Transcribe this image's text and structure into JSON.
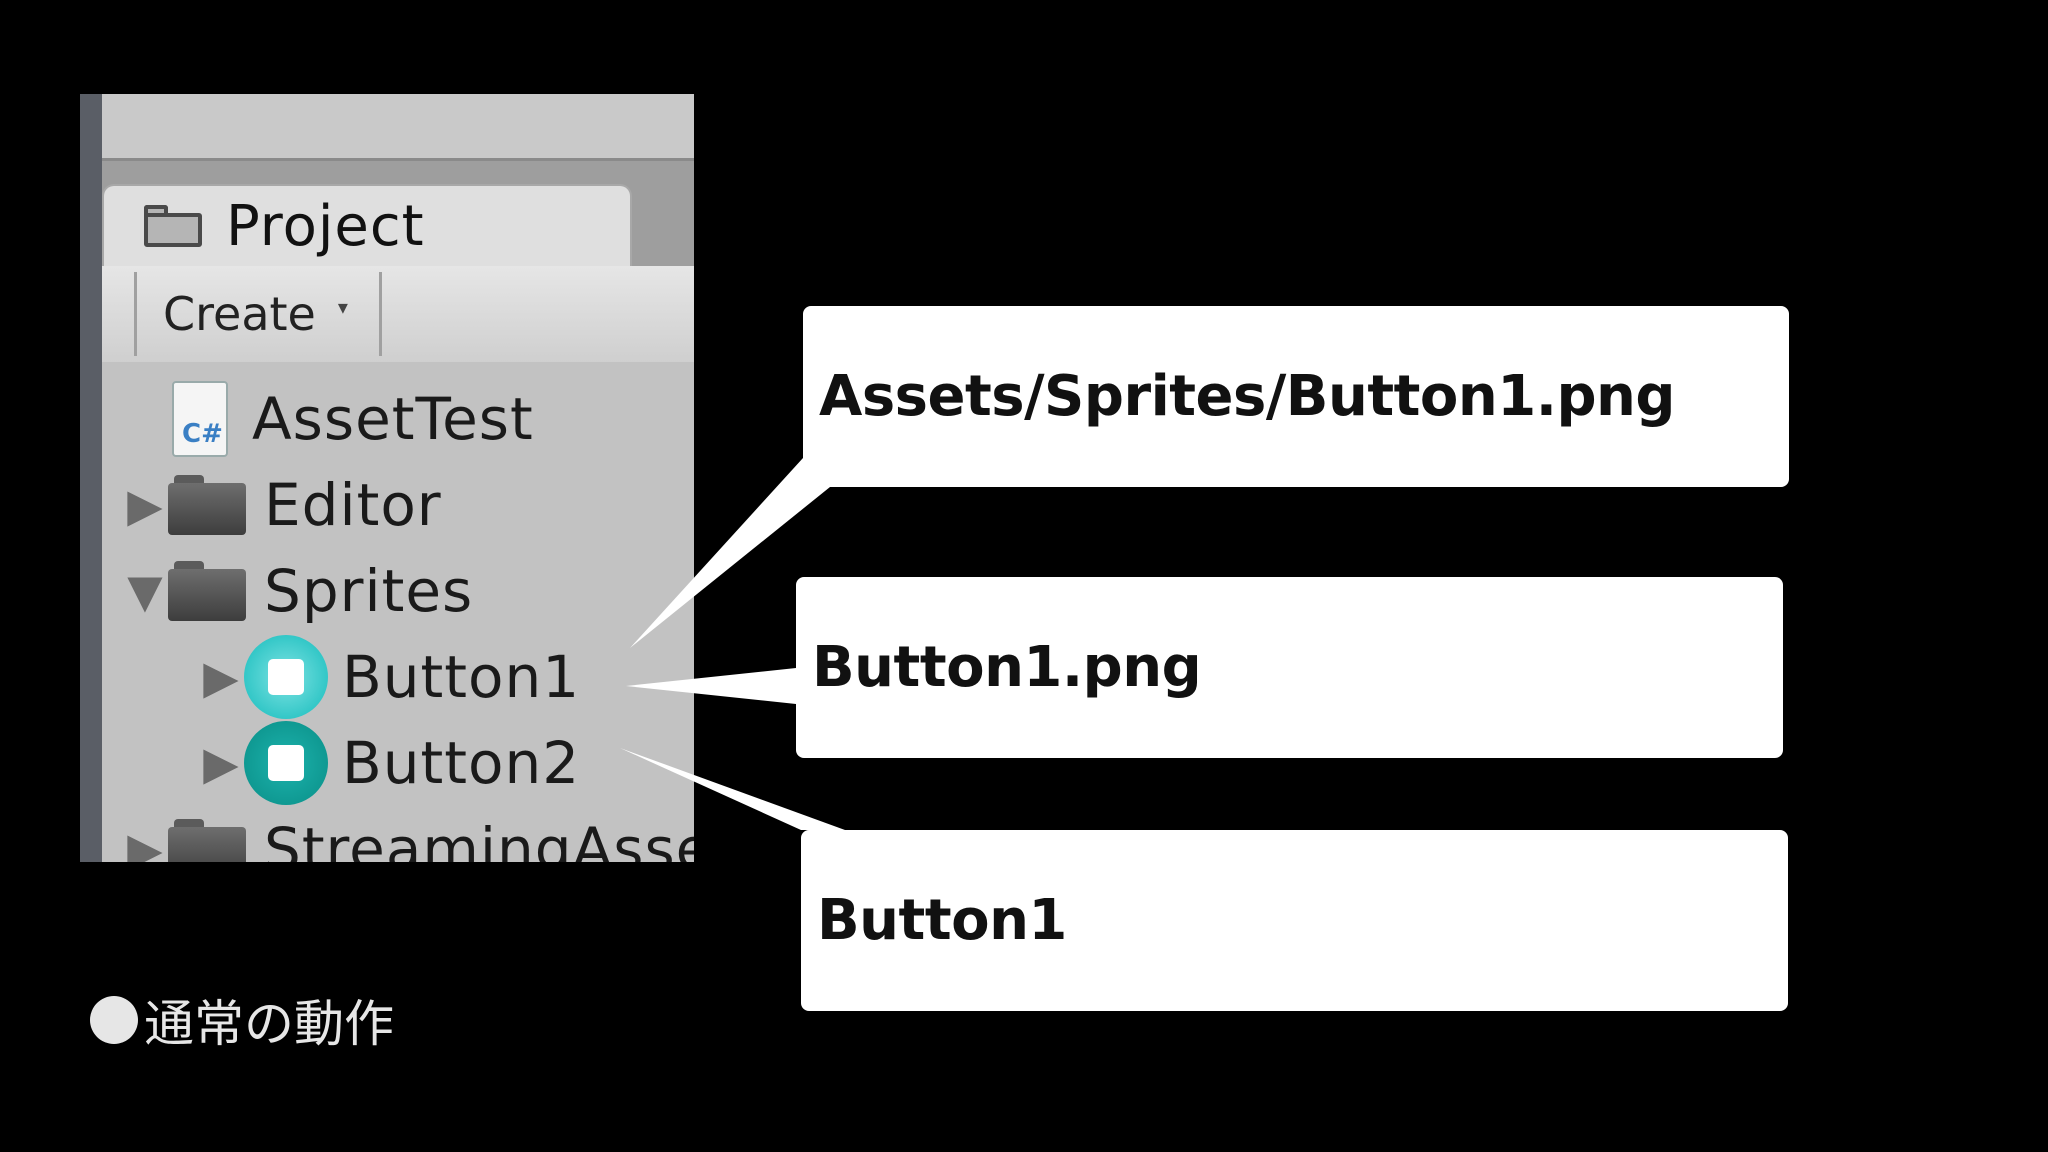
{
  "panel": {
    "tab_label": "Project",
    "toolbar": {
      "create_label": "Create",
      "create_caret": "▾"
    },
    "tree": {
      "items": [
        {
          "label": "AssetTest",
          "kind": "script",
          "arrow": "",
          "icon": "csharp-script-icon",
          "icon_text": "C#"
        },
        {
          "label": "Editor",
          "kind": "folder",
          "arrow": "▶",
          "icon": "folder-icon"
        },
        {
          "label": "Sprites",
          "kind": "folder",
          "arrow": "▼",
          "icon": "folder-icon"
        },
        {
          "label": "Button1",
          "kind": "sprite",
          "arrow": "▶",
          "icon": "sprite-icon"
        },
        {
          "label": "Button2",
          "kind": "sprite",
          "arrow": "▶",
          "icon": "sprite-icon"
        },
        {
          "label": "StreamingAssets",
          "kind": "folder",
          "arrow": "▶",
          "icon": "folder-icon"
        }
      ]
    }
  },
  "callouts": {
    "path": "Assets/Sprites/Button1.png",
    "file": "Button1.png",
    "name": "Button1"
  },
  "caption": {
    "text": "通常の動作"
  },
  "colors": {
    "background": "#000000",
    "panel": "#c2c2c2",
    "sprite_teal_light": "#33c7c7",
    "sprite_teal_dark": "#0f9992",
    "callout": "#ffffff"
  }
}
